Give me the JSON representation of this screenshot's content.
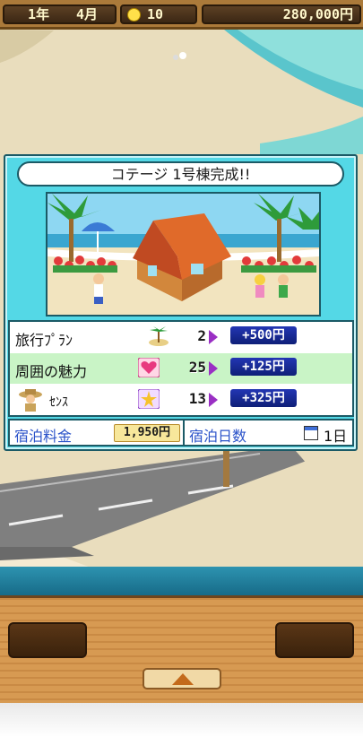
{
  "status_bar": {
    "year": "1年",
    "month": "4月",
    "ideas": "10",
    "money": "280,000円"
  },
  "dialog": {
    "title": "コテージ 1号棟完成!!",
    "stats": [
      {
        "label": "旅行ﾌﾟﾗﾝ",
        "value": "2",
        "gain": "+500円",
        "icon": "palm-island-icon"
      },
      {
        "label": "周囲の魅力",
        "value": "25",
        "gain": "+125円",
        "icon": "heart-icon"
      },
      {
        "label": "ｾﾝｽ",
        "value": "13",
        "gain": "+325円",
        "icon": "star-sparkle-icon"
      }
    ],
    "footer": {
      "price_label": "宿泊料金",
      "price_value": "1,950円",
      "days_label": "宿泊日数",
      "days_value": "1日"
    }
  },
  "colors": {
    "dialog_bg": "#54d8e6",
    "highlight_row": "#c9f4c6",
    "gain_badge": "#1a2c9c",
    "label_blue": "#2a52c9"
  }
}
